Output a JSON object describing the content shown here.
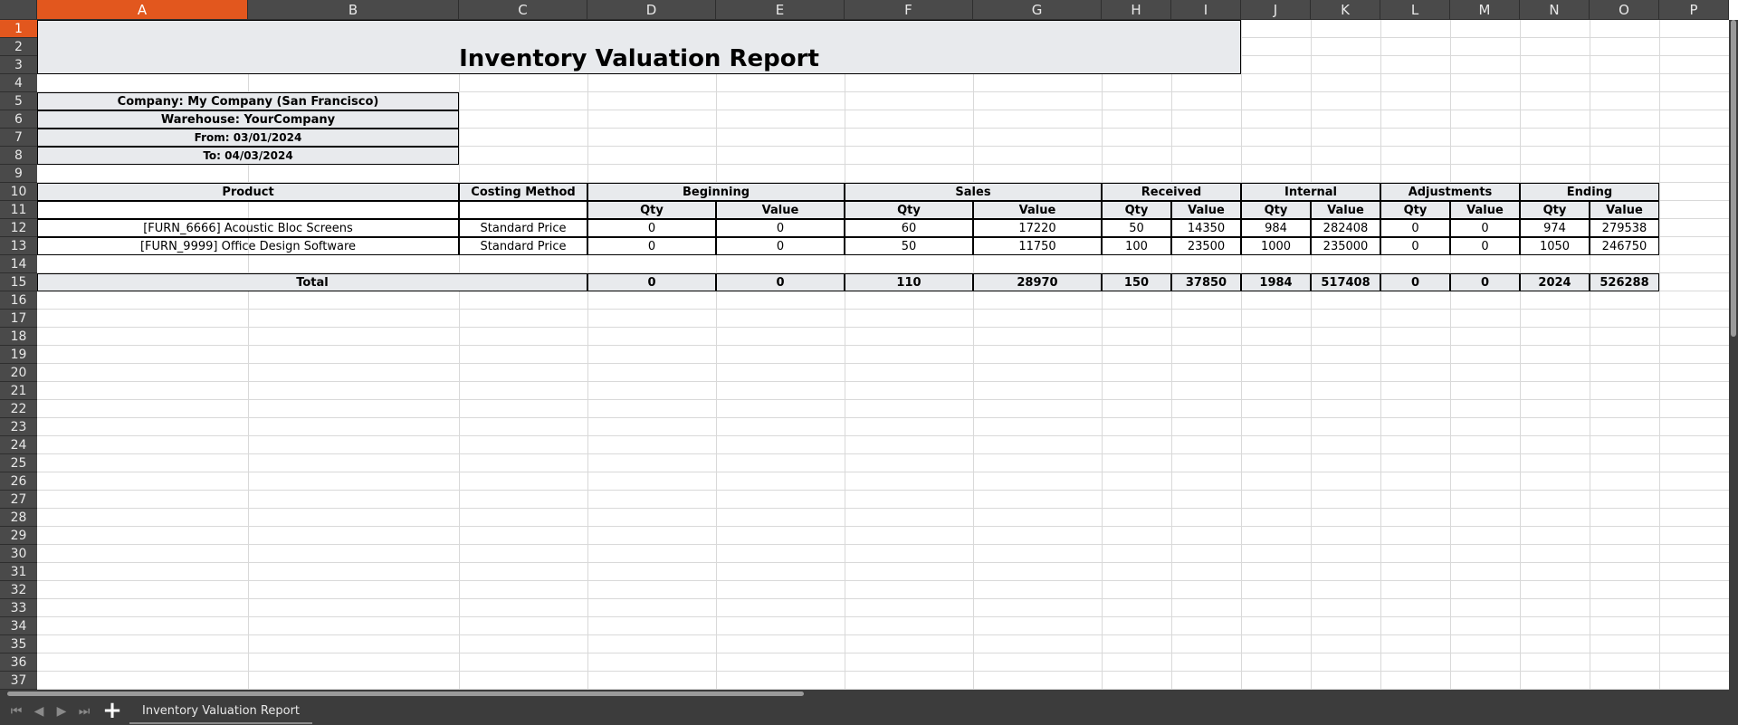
{
  "spreadsheet": {
    "columns": [
      "A",
      "B",
      "C",
      "D",
      "E",
      "F",
      "G",
      "H",
      "I",
      "J",
      "K",
      "L",
      "M",
      "N",
      "O",
      "P"
    ],
    "selected_column": "A",
    "selected_row": 1,
    "row_count": 37
  },
  "report": {
    "title": "Inventory Valuation Report",
    "company": "Company: My Company (San Francisco)",
    "warehouse": "Warehouse: YourCompany",
    "from": "From: 03/01/2024",
    "to": "To: 04/03/2024"
  },
  "table": {
    "header_product": "Product",
    "header_costing": "Costing Method",
    "groups": [
      "Beginning",
      "Sales",
      "Received",
      "Internal",
      "Adjustments",
      "Ending"
    ],
    "qty_label": "Qty",
    "value_label": "Value",
    "rows": [
      {
        "product": "[FURN_6666] Acoustic Bloc Screens",
        "method": "Standard Price",
        "values": [
          "0",
          "0",
          "60",
          "17220",
          "50",
          "14350",
          "984",
          "282408",
          "0",
          "0",
          "974",
          "279538"
        ]
      },
      {
        "product": "[FURN_9999] Office Design Software",
        "method": "Standard Price",
        "values": [
          "0",
          "0",
          "50",
          "11750",
          "100",
          "23500",
          "1000",
          "235000",
          "0",
          "0",
          "1050",
          "246750"
        ]
      }
    ],
    "total_label": "Total",
    "totals": [
      "0",
      "0",
      "110",
      "28970",
      "150",
      "37850",
      "1984",
      "517408",
      "0",
      "0",
      "2024",
      "526288"
    ]
  },
  "tabs": {
    "sheet_name": "Inventory Valuation Report",
    "add_symbol": "+",
    "nav_first": "⏮",
    "nav_prev": "◀",
    "nav_next": "▶",
    "nav_last": "⏭"
  },
  "colors": {
    "accent": "#e2571e",
    "header_fill": "#e8eaed",
    "chrome": "#4a4a4a"
  }
}
